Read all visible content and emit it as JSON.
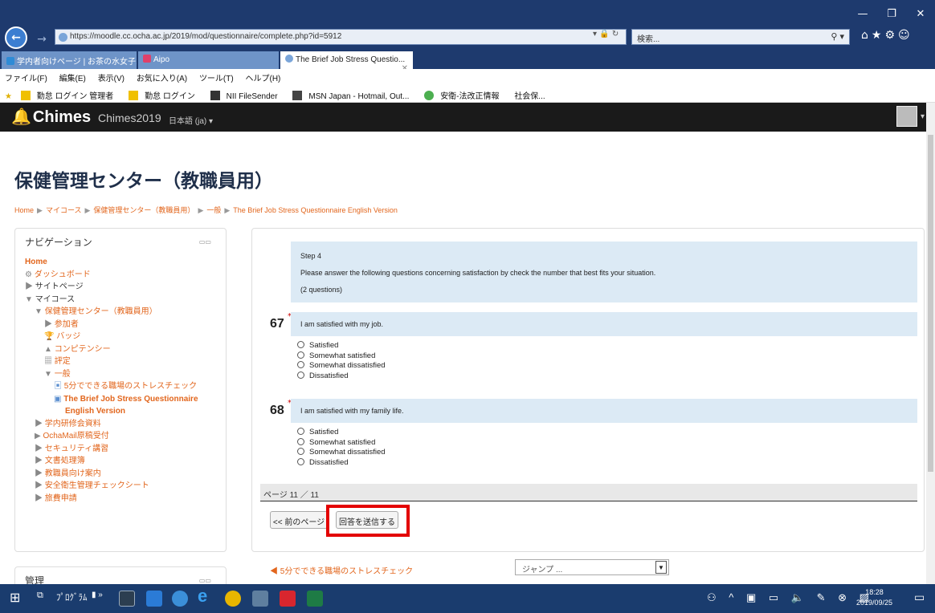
{
  "browser": {
    "url": "https://moodle.cc.ocha.ac.jp/2019/mod/questionnaire/complete.php?id=5912",
    "search_placeholder": "検索...",
    "tabs": [
      "学内者向けページ | お茶の水女子...",
      "Aipo",
      "The Brief Job Stress Questio..."
    ],
    "menu": [
      "ファイル(F)",
      "編集(E)",
      "表示(V)",
      "お気に入り(A)",
      "ツール(T)",
      "ヘルプ(H)"
    ],
    "favorites": [
      "勤怠 ログイン 管理者",
      "勤怠 ログイン",
      "NII FileSender",
      "MSN Japan - Hotmail, Out...",
      "安衛-法改正情報",
      "社会保..."
    ]
  },
  "header": {
    "logo": "Chimes",
    "site_name": "Chimes2019",
    "lang": "日本語 (ja) ▾"
  },
  "page": {
    "title": "保健管理センター（教職員用）",
    "breadcrumb": [
      "Home",
      "マイコース",
      "保健管理センター（教職員用）",
      "一般",
      "The Brief Job Stress Questionnaire English Version"
    ]
  },
  "nav": {
    "title": "ナビゲーション",
    "home": "Home",
    "dashboard": "ダッシュボード",
    "site_pages": "サイトページ",
    "my_courses": "マイコース",
    "course": "保健管理センター（教職員用）",
    "participants": "参加者",
    "badges": "バッジ",
    "competencies": "コンピテンシー",
    "grades": "評定",
    "general": "一般",
    "activity1": "5分でできる職場のストレスチェック",
    "activity2a": "The Brief Job Stress Questionnaire",
    "activity2b": "English Version",
    "c1": "学内研修会資料",
    "c2": "OchaMail原稿受付",
    "c3": "セキュリティ講習",
    "c4": "文書処理簿",
    "c5": "教職員向け案内",
    "c6": "安全衛生管理チェックシート",
    "c7": "旅費申請"
  },
  "admin_block": {
    "title": "管理"
  },
  "questionnaire": {
    "step_title": "Step 4",
    "step_text": "Please answer the following questions concerning satisfaction by check the number that best fits your situation.",
    "step_count": "(2 questions)",
    "q67": {
      "num": "67",
      "text": "I am satisfied with my job."
    },
    "q68": {
      "num": "68",
      "text": "I am satisfied with my family life."
    },
    "options": [
      "Satisfied",
      "Somewhat satisfied",
      "Somewhat dissatisfied",
      "Dissatisfied"
    ],
    "pager": "ページ 11 ／ 11",
    "prev_button": "<< 前のページ",
    "submit_button": "回答を送信する",
    "prev_activity_link": "◀ 5分でできる職場のストレスチェック",
    "jump_placeholder": "ジャンプ ..."
  },
  "taskbar": {
    "programs": "ﾌﾟﾛｸﾞﾗﾑ",
    "time": "18:28",
    "date": "2019/09/25"
  },
  "colors": {
    "accent": "#e2661d",
    "highlight": "#e30000",
    "panel": "#dceaf5"
  }
}
